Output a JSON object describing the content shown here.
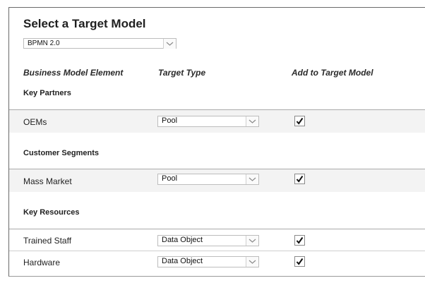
{
  "header": {
    "title": "Select a Target Model"
  },
  "model_select": {
    "value": "BPMN 2.0"
  },
  "columns": {
    "element": "Business Model Element",
    "type": "Target Type",
    "add": "Add to Target Model"
  },
  "sections": [
    {
      "title": "Key Partners",
      "rows": [
        {
          "element": "OEMs",
          "type": "Pool",
          "checked": true
        }
      ]
    },
    {
      "title": "Customer Segments",
      "rows": [
        {
          "element": "Mass Market",
          "type": "Pool",
          "checked": true
        }
      ]
    },
    {
      "title": "Key Resources",
      "rows": [
        {
          "element": "Trained Staff",
          "type": "Data Object",
          "checked": true
        },
        {
          "element": "Hardware",
          "type": "Data Object",
          "checked": true
        }
      ]
    }
  ]
}
